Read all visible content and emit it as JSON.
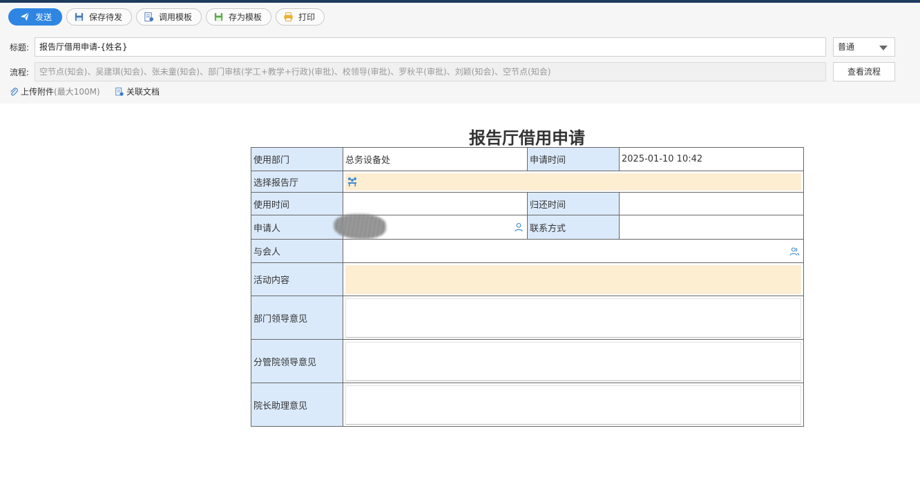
{
  "toolbar": {
    "send": "发送",
    "save_draft": "保存待发",
    "use_template": "调用模板",
    "save_template": "存为模板",
    "print": "打印"
  },
  "header": {
    "title_label": "标题:",
    "title_value": "报告厅借用申请-{姓名}",
    "priority": "普通",
    "flow_label": "流程:",
    "flow_value": "空节点(知会)、吴建琪(知会)、张未童(知会)、部门审核(学工+教学+行政)(审批)、校领导(审批)、罗秋平(审批)、刘颖(知会)、空节点(知会)",
    "view_flow": "查看流程",
    "upload": "上传附件",
    "upload_limit": "(最大100M)",
    "related_doc": "关联文档"
  },
  "form": {
    "title": "报告厅借用申请",
    "dept_label": "使用部门",
    "dept_value": "总务设备处",
    "apply_time_label": "申请时间",
    "apply_time_value": "2025-01-10 10:42",
    "hall_label": "选择报告厅",
    "use_time_label": "使用时间",
    "return_time_label": "归还时间",
    "applicant_label": "申请人",
    "contact_label": "联系方式",
    "attendees_label": "与会人",
    "activity_label": "活动内容",
    "dept_leader_label": "部门领导意见",
    "vp_leader_label": "分管院领导意见",
    "assistant_label": "院长助理意见"
  },
  "colors": {
    "primary": "#2f86e2",
    "label_bg": "#dbeafb",
    "highlight_bg": "#fdeed2",
    "topline": "#1e3a5c"
  }
}
